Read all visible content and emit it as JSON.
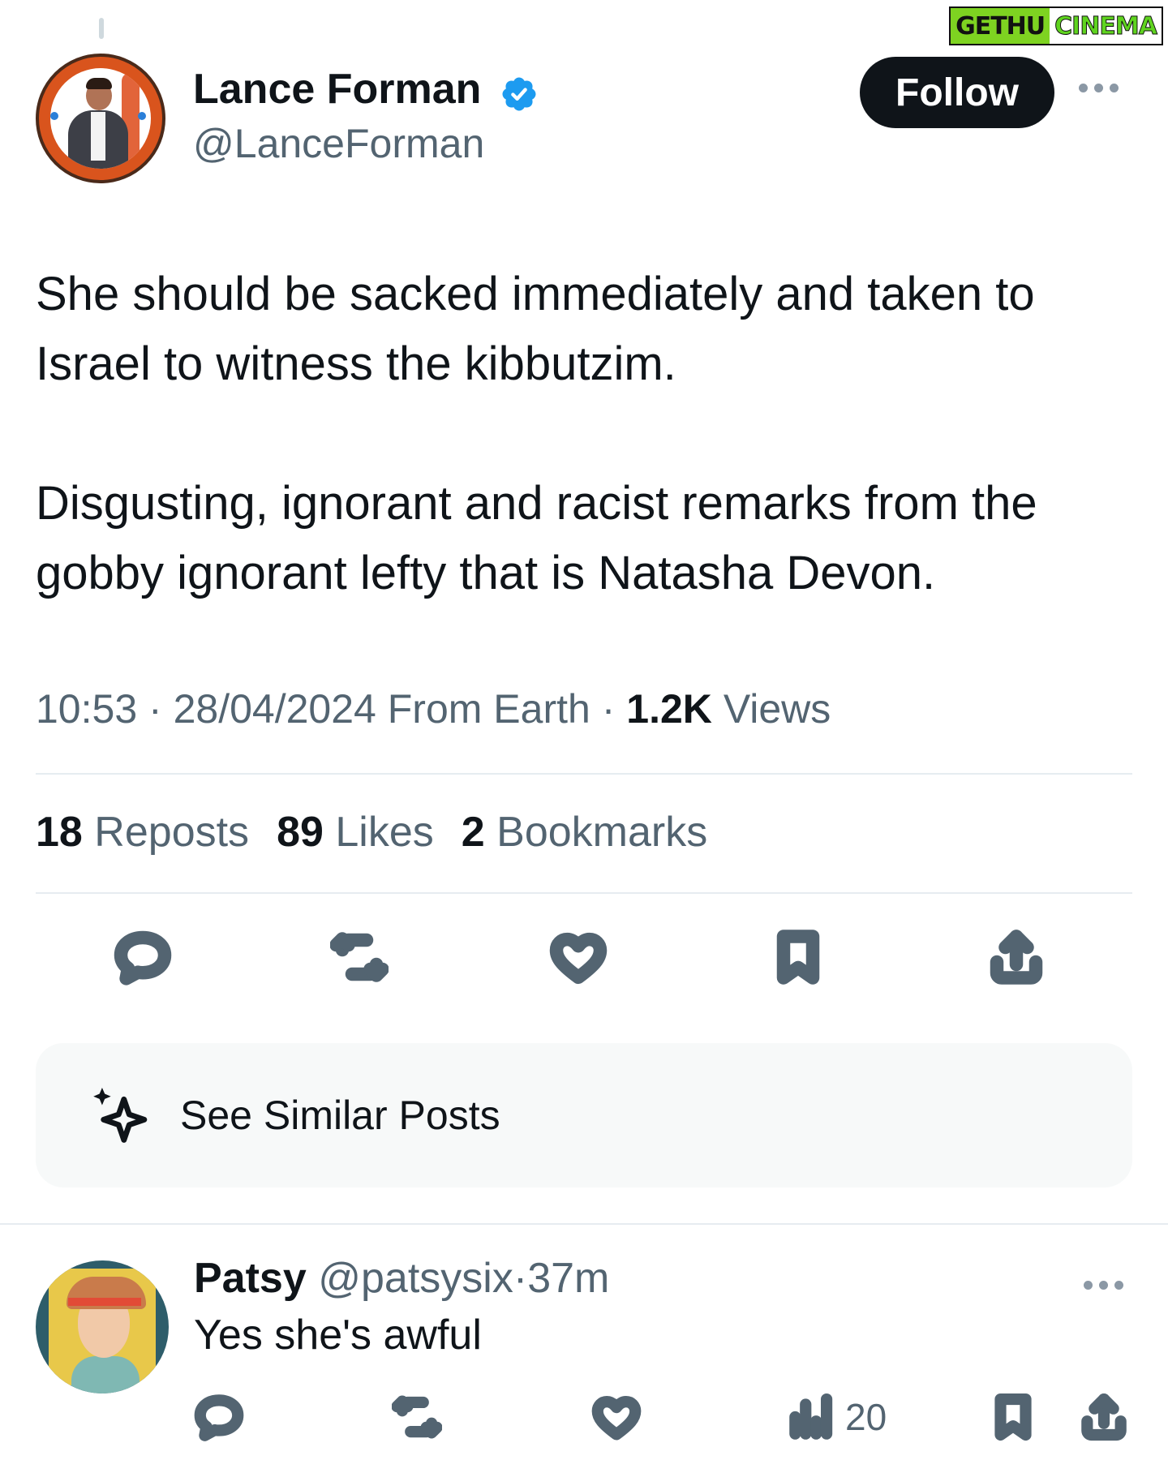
{
  "watermark": {
    "part1": "GETHU",
    "part2": "CINEMA"
  },
  "post": {
    "author_name": "Lance Forman",
    "handle": "@LanceForman",
    "follow_label": "Follow",
    "paragraphs": [
      "She should be sacked immediately and taken to Israel to witness the kibbutzim.",
      "Disgusting, ignorant and racist remarks from the gobby ignorant lefty that is Natasha Devon."
    ],
    "time": "10:53",
    "date": "28/04/2024",
    "source": "From Earth",
    "views_count": "1.2K",
    "views_label": "Views",
    "separator": "·",
    "stats": {
      "reposts_count": "18",
      "reposts_label": "Reposts",
      "likes_count": "89",
      "likes_label": "Likes",
      "bookmarks_count": "2",
      "bookmarks_label": "Bookmarks"
    },
    "icons": [
      "reply-icon",
      "repost-icon",
      "like-icon",
      "bookmark-icon",
      "share-icon"
    ]
  },
  "similar": {
    "label": "See Similar Posts",
    "icon": "sparkle-icon"
  },
  "reply": {
    "name": "Patsy",
    "handle": "@patsysix",
    "separator": "·",
    "age": "37m",
    "text": "Yes she's awful",
    "views_count": "20",
    "icons": [
      "reply-icon",
      "repost-icon",
      "like-icon",
      "views-icon",
      "bookmark-icon",
      "share-icon"
    ]
  },
  "colors": {
    "text_primary": "#0f1419",
    "text_secondary": "#536471",
    "verified_blue": "#1d9bf0",
    "follow_bg": "#0f1419",
    "card_bg": "#f7f9f9",
    "divider": "#e6ecf0"
  }
}
